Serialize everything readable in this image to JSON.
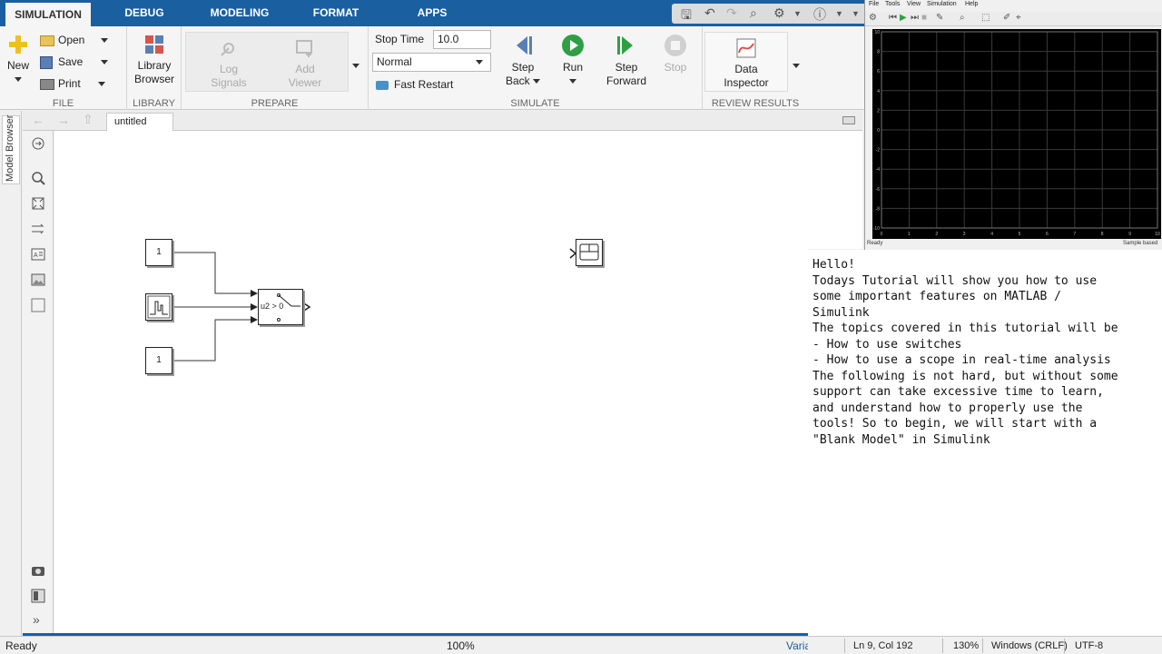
{
  "tabs": [
    {
      "label": "SIMULATION",
      "active": true
    },
    {
      "label": "DEBUG"
    },
    {
      "label": "MODELING"
    },
    {
      "label": "FORMAT"
    },
    {
      "label": "APPS"
    }
  ],
  "ribbon": {
    "file": {
      "new_label": "New",
      "open_label": "Open",
      "save_label": "Save",
      "print_label": "Print",
      "group_label": "FILE"
    },
    "library": {
      "label_line1": "Library",
      "label_line2": "Browser",
      "group_label": "LIBRARY"
    },
    "prepare": {
      "log_line1": "Log",
      "log_line2": "Signals",
      "add_line1": "Add",
      "add_line2": "Viewer",
      "group_label": "PREPARE"
    },
    "simulate": {
      "stop_time_label": "Stop Time",
      "stop_time_value": "10.0",
      "mode_value": "Normal",
      "fast_restart_label": "Fast Restart",
      "step_back_line1": "Step",
      "step_back_line2": "Back",
      "run_label": "Run",
      "step_fwd_line1": "Step",
      "step_fwd_line2": "Forward",
      "stop_label": "Stop",
      "group_label": "SIMULATE"
    },
    "review": {
      "label_line1": "Data",
      "label_line2": "Inspector",
      "group_label": "REVIEW RESULTS"
    }
  },
  "model_browser": {
    "label": "Model Browser"
  },
  "editor": {
    "tab_label": "untitled"
  },
  "blocks": {
    "constant1_value": "1",
    "constant2_value": "1",
    "switch_label": "u2 > 0"
  },
  "scope": {
    "menu": [
      "File",
      "Tools",
      "View",
      "Simulation",
      "Help"
    ],
    "y_ticks": [
      "10",
      "8",
      "6",
      "4",
      "2",
      "0",
      "-2",
      "-4",
      "-6",
      "-8",
      "-10"
    ],
    "x_ticks": [
      "0",
      "1",
      "2",
      "3",
      "4",
      "5",
      "6",
      "7",
      "8",
      "9",
      "10"
    ],
    "status_left": "Ready",
    "status_right": "Sample based",
    "colors": {
      "background": "#000000",
      "grid": "#3a3a3a"
    }
  },
  "notes": {
    "lines": [
      "Hello!",
      "",
      "Todays Tutorial will show you how to use",
      "some important features on MATLAB /",
      "Simulink",
      "",
      "The topics covered in this tutorial will be",
      "- How to use switches",
      "- How to use a scope in real-time analysis",
      "",
      "The following is not hard, but without some",
      "support can take excessive time to learn,",
      "and understand how to properly use the",
      "tools! So to begin, we will start with a",
      "\"Blank Model\" in Simulink"
    ]
  },
  "status": {
    "ready": "Ready",
    "zoom": "100%",
    "solver": "Varia"
  },
  "editor_status": {
    "position": "Ln 9, Col 192",
    "zoom": "130%",
    "line_ending": "Windows (CRLF)",
    "encoding": "UTF-8"
  },
  "colors": {
    "tabbar": "#1a5fa0",
    "run_green": "#2ea043"
  }
}
